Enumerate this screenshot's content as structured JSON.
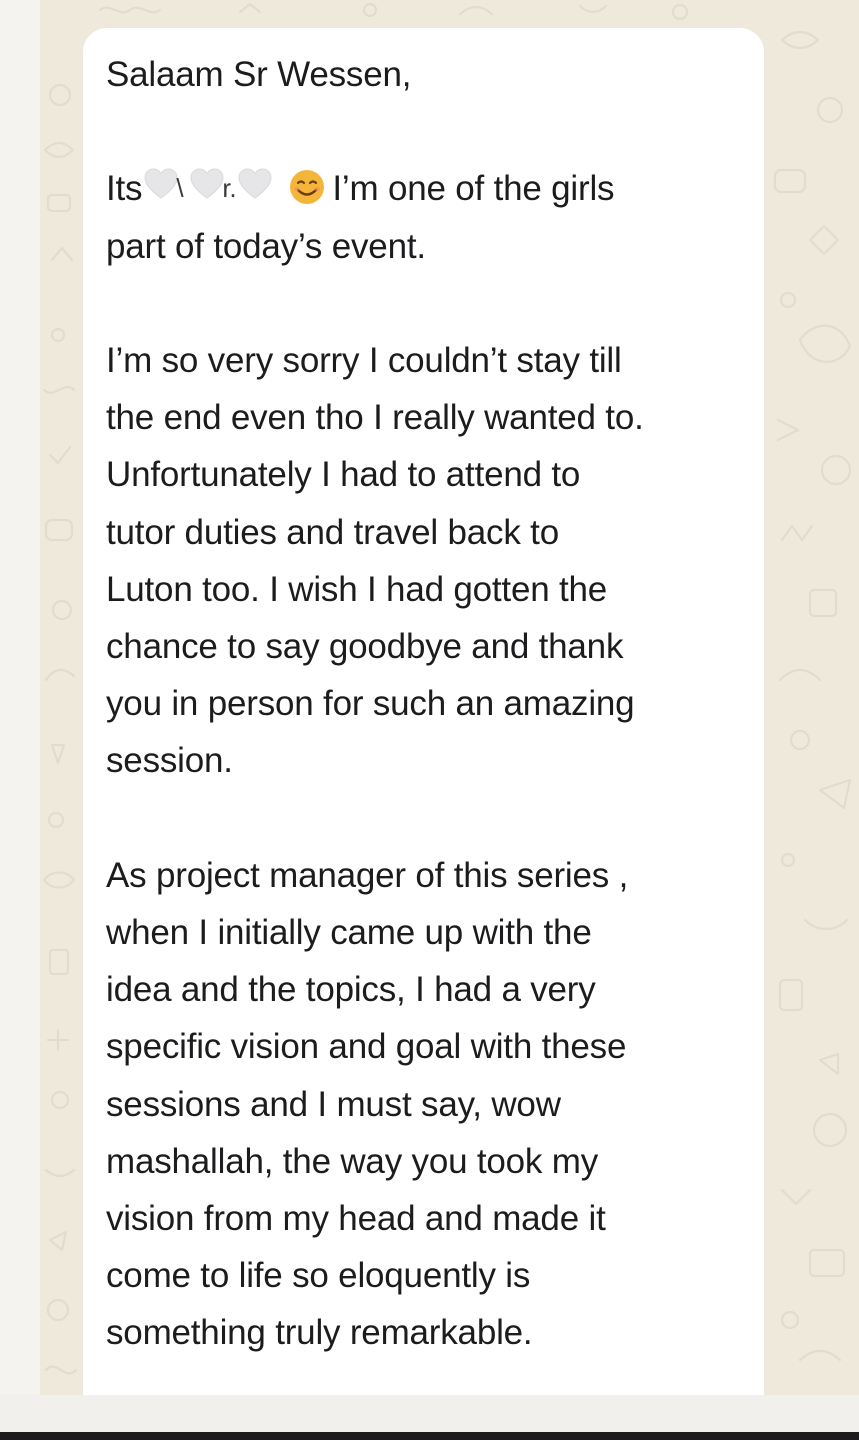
{
  "chat": {
    "message": {
      "greeting": "Salaam Sr Wessen,",
      "intro": {
        "prefix": "Its",
        "redaction_fragment_1": "\\",
        "redaction_fragment_2": "r.",
        "emoji": "smiling-face-emoji",
        "line1_suffix": "I’m one of the girls",
        "line2": "part of today’s event."
      },
      "paragraph2": [
        "I’m so very sorry I couldn’t stay till",
        "the end even tho I really wanted to.",
        "Unfortunately I had to attend to",
        "tutor duties and travel back to",
        "Luton too. I wish I had gotten the",
        "chance to say goodbye and thank",
        "you in person for such an amazing",
        "session."
      ],
      "paragraph3": [
        "As project manager of this series ,",
        "when I initially came up with the",
        "idea and the topics, I had a very",
        "specific vision and goal with these",
        "sessions and I must say, wow",
        "mashallah, the way you took my",
        "vision from my head and made it",
        "come to life so eloquently is",
        "something truly remarkable."
      ]
    }
  },
  "colors": {
    "bubble": "#ffffff",
    "wallpaper": "#efe9dc",
    "text": "#1c1c1e",
    "heart": "#e6e6e8",
    "emoji": "#f4b63a"
  }
}
